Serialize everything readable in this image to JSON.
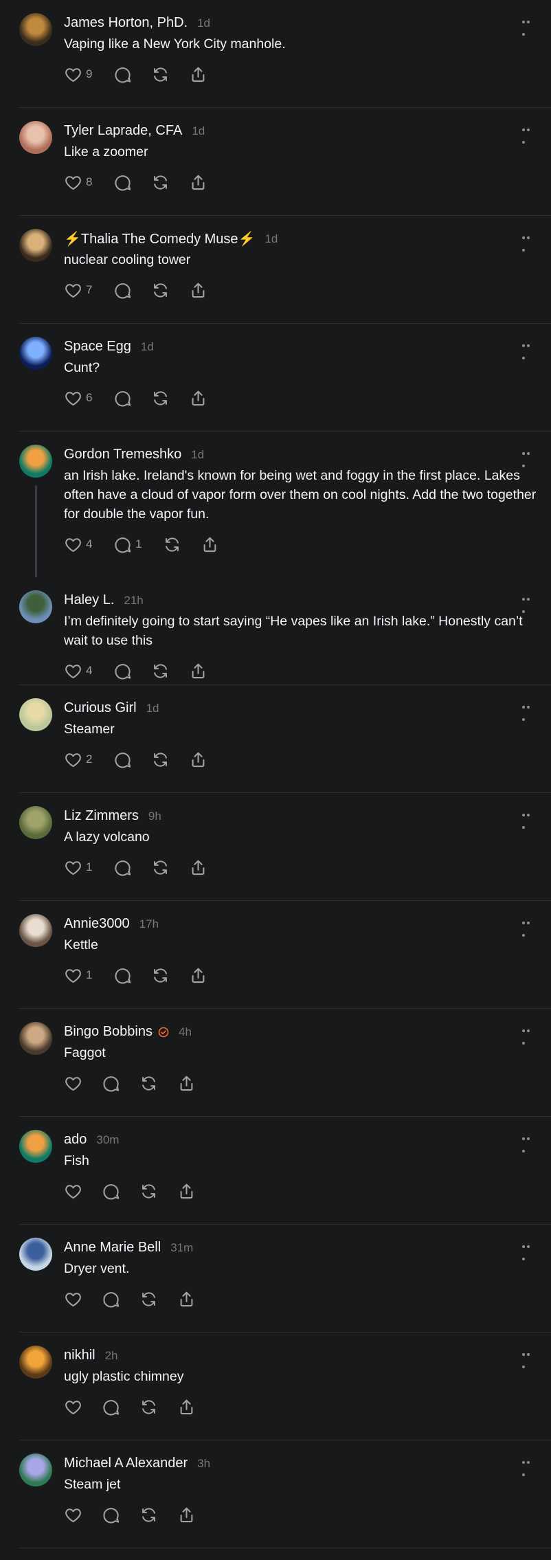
{
  "posts": [
    {
      "name": "James Horton, PhD.",
      "time": "1d",
      "text": "Vaping like a New York City manhole.",
      "likes": "9",
      "replies": "",
      "avatar": {
        "bg": "#3b2d1c",
        "fg": "#c08a3d"
      }
    },
    {
      "name": "Tyler Laprade, CFA",
      "time": "1d",
      "text": "Like a zoomer",
      "likes": "8",
      "replies": "",
      "avatar": {
        "bg": "#b06e5a",
        "fg": "#e9c2ad"
      }
    },
    {
      "name": "⚡Thalia The Comedy Muse⚡",
      "time": "1d",
      "text": "nuclear cooling tower",
      "likes": "7",
      "replies": "",
      "avatar": {
        "bg": "#3a2a1c",
        "fg": "#d9b27a"
      }
    },
    {
      "name": "Space Egg",
      "time": "1d",
      "text": "Cunt?",
      "likes": "6",
      "replies": "",
      "avatar": {
        "bg": "#0c1f5a",
        "fg": "#7fb0ff"
      }
    },
    {
      "name": "Gordon Tremeshko",
      "time": "1d",
      "text": "an Irish lake. Ireland's known for being wet and foggy in the first place. Lakes often have a cloud of vapor form over them on cool nights. Add the two together for double the vapor fun.",
      "likes": "4",
      "replies": "1",
      "avatar": {
        "bg": "#0f7a66",
        "fg": "#f0a043"
      }
    },
    {
      "name": "Haley L.",
      "time": "21h",
      "text": "I’m definitely going to start saying “He vapes like an Irish lake.” Honestly can’t wait to use this",
      "likes": "4",
      "replies": "",
      "avatar": {
        "bg": "#6d8fb6",
        "fg": "#3f5f3a"
      }
    },
    {
      "name": "Curious Girl",
      "time": "1d",
      "text": "Steamer",
      "likes": "2",
      "replies": "",
      "avatar": {
        "bg": "#b9c79a",
        "fg": "#e7d9a8"
      }
    },
    {
      "name": "Liz Zimmers",
      "time": "9h",
      "text": "A lazy volcano",
      "likes": "1",
      "replies": "",
      "avatar": {
        "bg": "#5a6b3a",
        "fg": "#a0a36b"
      }
    },
    {
      "name": "Annie3000",
      "time": "17h",
      "text": "Kettle",
      "likes": "1",
      "replies": "",
      "avatar": {
        "bg": "#6b5645",
        "fg": "#e8ddd0"
      }
    },
    {
      "name": "Bingo Bobbins",
      "time": "4h",
      "text": "Faggot",
      "likes": "",
      "replies": "",
      "verified": true,
      "avatar": {
        "bg": "#4a3a2b",
        "fg": "#cda882"
      }
    },
    {
      "name": "ado",
      "time": "30m",
      "text": "Fish",
      "likes": "",
      "replies": "",
      "avatar": {
        "bg": "#0f7a66",
        "fg": "#f0a043"
      }
    },
    {
      "name": "Anne Marie Bell",
      "time": "31m",
      "text": "Dryer vent.",
      "likes": "",
      "replies": "",
      "avatar": {
        "bg": "#c7d6e6",
        "fg": "#3a5f9a"
      }
    },
    {
      "name": "nikhil",
      "time": "2h",
      "text": "ugly plastic chimney",
      "likes": "",
      "replies": "",
      "avatar": {
        "bg": "#5a3a16",
        "fg": "#f2a43a"
      }
    },
    {
      "name": "Michael A Alexander",
      "time": "3h",
      "text": "Steam jet",
      "likes": "",
      "replies": "",
      "avatar": {
        "bg": "#2f7a54",
        "fg": "#a9a6e8"
      }
    }
  ],
  "colors": {
    "background": "#18191b",
    "verified": "#ff6a2a"
  }
}
